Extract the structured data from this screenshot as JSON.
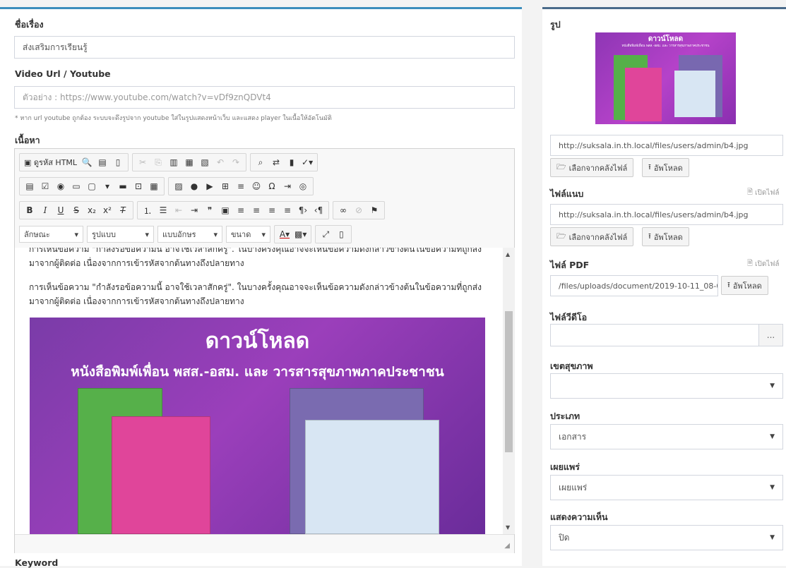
{
  "left": {
    "title_label": "ชื่อเรื่อง",
    "title_value": "ส่งเสริมการเรียนรู้",
    "video_label": "Video Url / Youtube",
    "video_placeholder": "ตัวอย่าง : https://www.youtube.com/watch?v=vDf9znQDVt4",
    "video_help": "* หาก url youtube ถูกต้อง ระบบจะดึงรูปจาก youtube ใส่ในรูปแสดงหน้าเว็บ และแสดง player ในเนื้อให้อัตโนมัติ",
    "content_label": "เนื้อหา",
    "keyword_label": "Keyword"
  },
  "editor": {
    "source_label": "ดูรหัส HTML",
    "combo_format": "ลักษณะ",
    "combo_style": "รูปแบบ",
    "combo_font": "แบบอักษร",
    "combo_size": "ขนาด",
    "paragraph1": "การเห็นข้อความ \"กำลังรอข้อความนี้ อาจใช้เวลาสักครู่\". ในบางครั้งคุณอาจจะเห็นข้อความดังกล่าวข้างต้นในข้อความที่ถูกส่งมาจากผู้ติดต่อ เนื่องจากการเข้ารหัสจากต้นทางถึงปลายทาง",
    "paragraph2": "การเห็นข้อความ \"กำลังรอข้อความนี้ อาจใช้เวลาสักครู่\". ในบางครั้งคุณอาจจะเห็นข้อความดังกล่าวข้างต้นในข้อความที่ถูกส่งมาจากผู้ติดต่อ เนื่องจากการเข้ารหัสจากต้นทางถึงปลายทาง",
    "banner_title": "ดาวน์โหลด",
    "banner_subtitle": "หนังสือพิมพ์เพื่อน พสส.-อสม. และ วารสารสุขภาพภาคประชาชน"
  },
  "right": {
    "image_label": "รูป",
    "thumb_title": "ดาวน์โหลด",
    "thumb_subtitle": "หนังสือพิมพ์เพื่อน พสส.-อสม. และ วารสารสุขภาพภาคประชาชน",
    "image_url": "http://suksala.in.th.local/files/users/admin/b4.jpg",
    "choose_library": "เลือกจากคลังไฟล์",
    "upload": "อัพโหลด",
    "attach_label": "ไฟล์แนบ",
    "open_file": "เปิดไฟล์",
    "attach_url": "http://suksala.in.th.local/files/users/admin/b4.jpg",
    "pdf_label": "ไฟล์ PDF",
    "pdf_path": "/files/uploads/document/2019-10-11_08-0",
    "video_file_label": "ไฟล์วีดีโอ",
    "video_file_value": "",
    "browse": "...",
    "region_label": "เขตสุขภาพ",
    "region_value": "",
    "type_label": "ประเภท",
    "type_value": "เอกสาร",
    "publish_label": "เผยแพร่",
    "publish_value": "เผยแพร่",
    "comment_label": "แสดงความเห็น",
    "comment_value": "ปิด"
  },
  "colors": {
    "accent_left": "#3c8dbc",
    "accent_right": "#4a6b8a",
    "banner": "#9b3fbb"
  }
}
